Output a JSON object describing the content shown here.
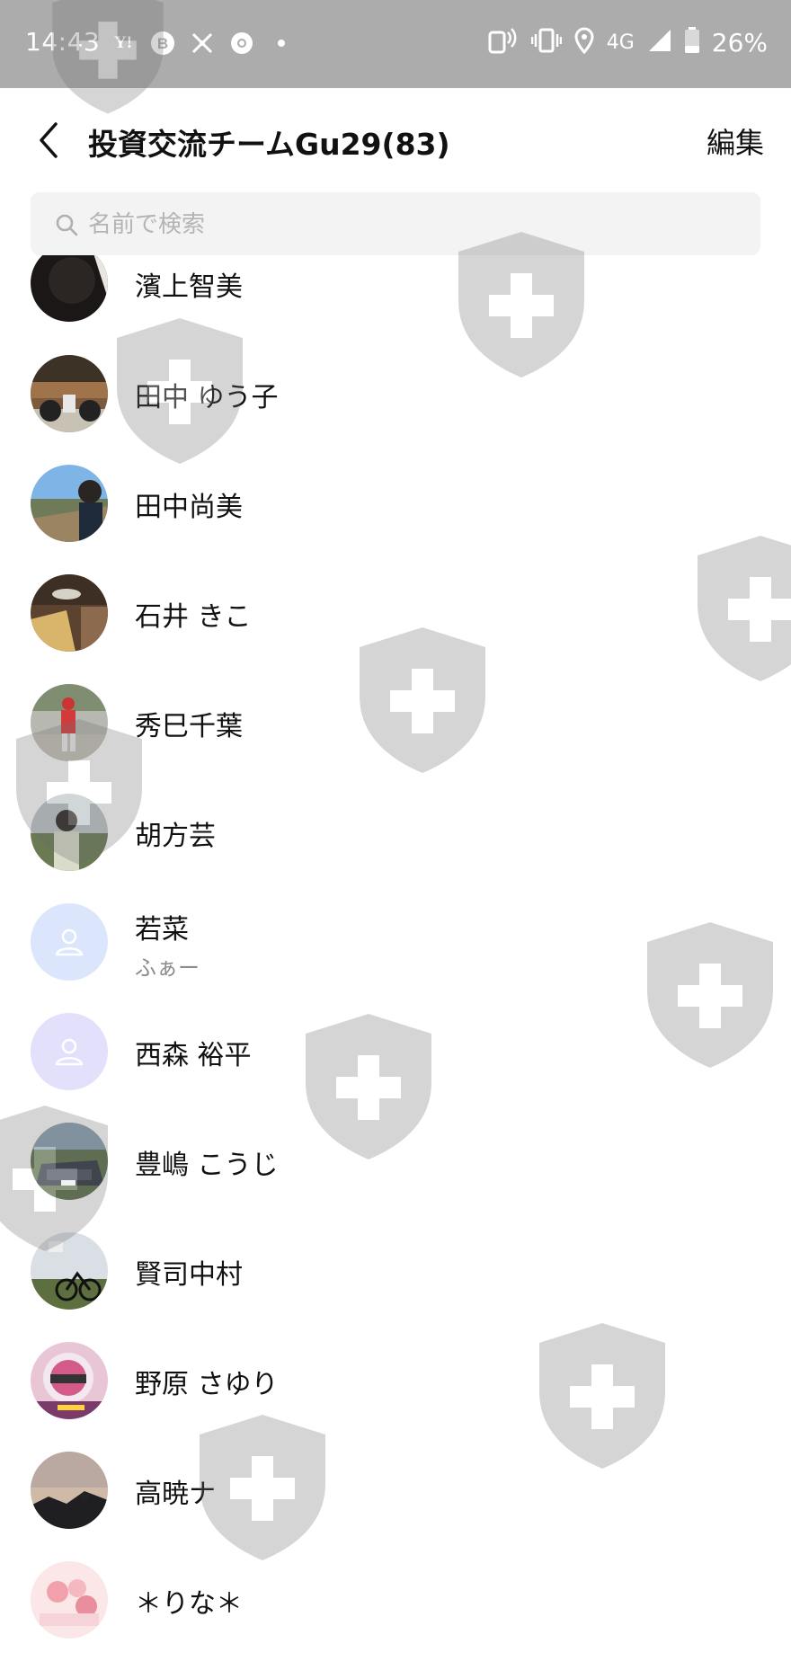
{
  "status_bar": {
    "time": "14:43",
    "left_icons": [
      "yahoo-icon",
      "b-app-icon",
      "app-icon",
      "chrome-icon",
      "dot-icon"
    ],
    "network": "4G",
    "battery": "26%"
  },
  "header": {
    "title": "投資交流チームGu29(83)",
    "edit_label": "編集"
  },
  "search": {
    "placeholder": "名前で検索",
    "value": ""
  },
  "members": [
    {
      "name": "濱上智美",
      "sub": "",
      "avatar": "photo-dark"
    },
    {
      "name": "田中 ゆう子",
      "sub": "",
      "avatar": "photo-motorbike"
    },
    {
      "name": "田中尚美",
      "sub": "",
      "avatar": "photo-sky"
    },
    {
      "name": "石井 きこ",
      "sub": "",
      "avatar": "photo-cafe"
    },
    {
      "name": "秀巳千葉",
      "sub": "",
      "avatar": "photo-runner"
    },
    {
      "name": "胡方芸",
      "sub": "",
      "avatar": "photo-woman"
    },
    {
      "name": "若菜",
      "sub": "ふぁー",
      "avatar": "default-blue"
    },
    {
      "name": "西森 裕平",
      "sub": "",
      "avatar": "default-purple"
    },
    {
      "name": "豊嶋 こうじ",
      "sub": "",
      "avatar": "photo-car"
    },
    {
      "name": "賢司中村",
      "sub": "",
      "avatar": "photo-bicycle"
    },
    {
      "name": "野原 さゆり",
      "sub": "",
      "avatar": "photo-helmet"
    },
    {
      "name": "高暁ナ",
      "sub": "",
      "avatar": "photo-sunset"
    },
    {
      "name": "＊りな＊",
      "sub": "",
      "avatar": "photo-flowers"
    }
  ],
  "colors": {
    "status_bar": "#acacac",
    "search_bg": "#f3f3f4",
    "default_avatar_blue": "#dbe5fb",
    "default_avatar_purple": "#e3e0fb"
  }
}
